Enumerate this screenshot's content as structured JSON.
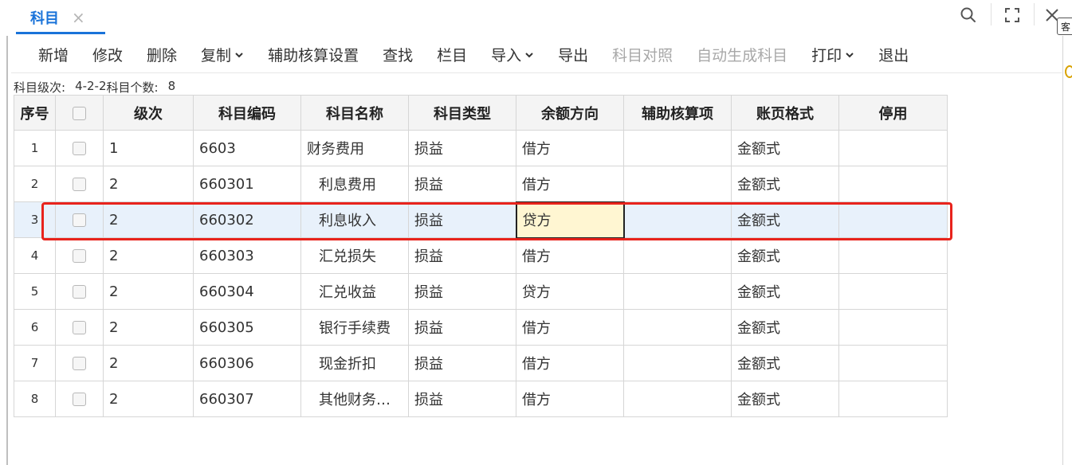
{
  "tab": {
    "label": "科目",
    "close": "×"
  },
  "window": {
    "edge_tag": "客"
  },
  "toolbar": {
    "items": [
      {
        "label": "新增",
        "disabled": false,
        "has_menu": false
      },
      {
        "label": "修改",
        "disabled": false,
        "has_menu": false
      },
      {
        "label": "删除",
        "disabled": false,
        "has_menu": false
      },
      {
        "label": "复制",
        "disabled": false,
        "has_menu": true
      },
      {
        "label": "辅助核算设置",
        "disabled": false,
        "has_menu": false
      },
      {
        "label": "查找",
        "disabled": false,
        "has_menu": false
      },
      {
        "label": "栏目",
        "disabled": false,
        "has_menu": false
      },
      {
        "label": "导入",
        "disabled": false,
        "has_menu": true
      },
      {
        "label": "导出",
        "disabled": false,
        "has_menu": false
      },
      {
        "label": "科目对照",
        "disabled": true,
        "has_menu": false
      },
      {
        "label": "自动生成科目",
        "disabled": true,
        "has_menu": false
      },
      {
        "label": "打印",
        "disabled": false,
        "has_menu": true
      },
      {
        "label": "退出",
        "disabled": false,
        "has_menu": false
      }
    ]
  },
  "info": {
    "level_label": "科目级次:",
    "level_value": "4-2-2",
    "count_label": "科目个数:",
    "count_value": "8"
  },
  "table": {
    "headers": [
      "序号",
      "",
      "级次",
      "科目编码",
      "科目名称",
      "科目类型",
      "余额方向",
      "辅助核算项",
      "账页格式",
      "停用"
    ],
    "rows": [
      {
        "seq": "1",
        "level": "1",
        "code": "6603",
        "name": "财务费用",
        "type": "损益",
        "direction": "借方",
        "aux": "",
        "format": "金额式",
        "disabled": ""
      },
      {
        "seq": "2",
        "level": "2",
        "code": "660301",
        "name": "利息费用",
        "type": "损益",
        "direction": "借方",
        "aux": "",
        "format": "金额式",
        "disabled": ""
      },
      {
        "seq": "3",
        "level": "2",
        "code": "660302",
        "name": "利息收入",
        "type": "损益",
        "direction": "贷方",
        "aux": "",
        "format": "金额式",
        "disabled": ""
      },
      {
        "seq": "4",
        "level": "2",
        "code": "660303",
        "name": "汇兑损失",
        "type": "损益",
        "direction": "借方",
        "aux": "",
        "format": "金额式",
        "disabled": ""
      },
      {
        "seq": "5",
        "level": "2",
        "code": "660304",
        "name": "汇兑收益",
        "type": "损益",
        "direction": "贷方",
        "aux": "",
        "format": "金额式",
        "disabled": ""
      },
      {
        "seq": "6",
        "level": "2",
        "code": "660305",
        "name": "银行手续费",
        "type": "损益",
        "direction": "借方",
        "aux": "",
        "format": "金额式",
        "disabled": ""
      },
      {
        "seq": "7",
        "level": "2",
        "code": "660306",
        "name": "现金折扣",
        "type": "损益",
        "direction": "借方",
        "aux": "",
        "format": "金额式",
        "disabled": ""
      },
      {
        "seq": "8",
        "level": "2",
        "code": "660307",
        "name": "其他财务费用",
        "type": "损益",
        "direction": "借方",
        "aux": "",
        "format": "金额式",
        "disabled": ""
      }
    ],
    "selected_row": 2,
    "active_cell_column": "direction"
  },
  "colors": {
    "accent": "#1a73d9",
    "highlight_border": "#e8231c",
    "selected_row_bg": "#e8f1fb",
    "active_cell_bg": "#fff6d2"
  }
}
